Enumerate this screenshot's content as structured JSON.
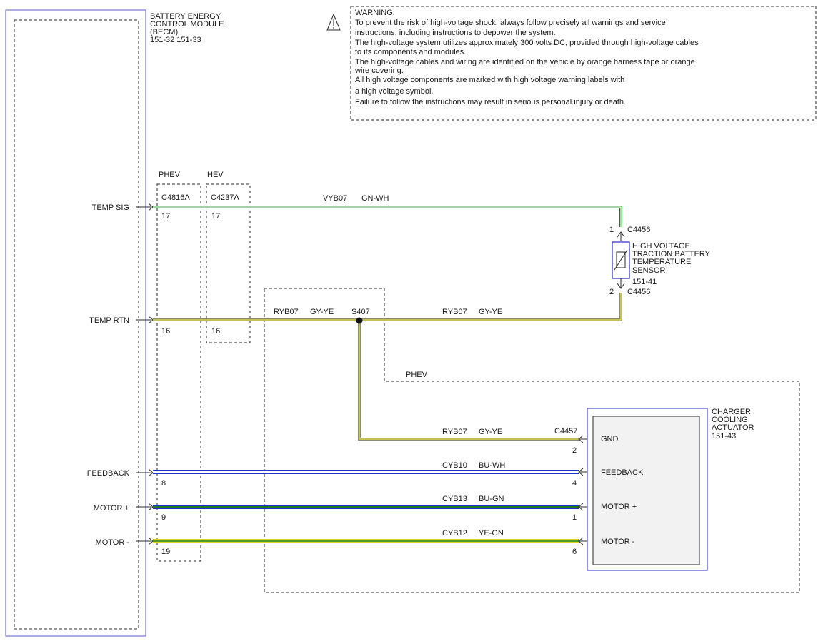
{
  "module_becm": {
    "title_lines": [
      "BATTERY ENERGY",
      "CONTROL MODULE",
      "(BECM)",
      "151-32  151-33"
    ]
  },
  "warning": {
    "title": "WARNING:",
    "lines": [
      "To prevent the risk of high-voltage shock, always follow precisely all warnings and service",
      "instructions, including instructions to depower the system.",
      "The high-voltage system utilizes approximately 300 volts DC, provided through high-voltage cables",
      "to its components and modules.",
      "The high-voltage cables and wiring are identified on the vehicle by orange harness tape or orange",
      "wire covering.",
      "All high voltage components are marked with high voltage warning labels with",
      "a high voltage symbol.",
      "Failure to follow the instructions may result in serious personal injury or death."
    ]
  },
  "option_labels": {
    "phev": "PHEV",
    "hev": "HEV",
    "phev_zone": "PHEV"
  },
  "connectors": {
    "c4816a": "C4816A",
    "c4237a": "C4237A",
    "c4456_top": "C4456",
    "c4456_bottom": "C4456",
    "c4457": "C4457"
  },
  "splice": "S407",
  "signals": [
    "TEMP SIG",
    "TEMP RTN",
    "FEEDBACK",
    "MOTOR +",
    "MOTOR -"
  ],
  "becm_pins": {
    "phev": [
      "17",
      "16",
      "8",
      "9",
      "19"
    ],
    "hev": [
      "17",
      "16"
    ]
  },
  "sensor": {
    "name_lines": [
      "HIGH VOLTAGE",
      "TRACTION BATTERY",
      "TEMPERATURE",
      "SENSOR",
      "151-41"
    ],
    "pin_top": "1",
    "pin_bottom": "2"
  },
  "actuator": {
    "name_lines": [
      "CHARGER",
      "COOLING",
      "ACTUATOR",
      "151-43"
    ],
    "pin_labels": [
      "GND",
      "FEEDBACK",
      "MOTOR +",
      "MOTOR -"
    ],
    "pin_numbers": [
      "2",
      "4",
      "1",
      "6"
    ]
  },
  "wires": [
    {
      "circuit": "VYB07",
      "color_code": "GN-WH",
      "main": "#1f7a1f",
      "stripe": "#ffffff"
    },
    {
      "circuit": "RYB07",
      "color_code": "GY-YE",
      "main": "#8a8a78",
      "stripe": "#e8df3a"
    },
    {
      "circuit": "RYB07",
      "color_code": "GY-YE",
      "main": "#8a8a78",
      "stripe": "#e8df3a"
    },
    {
      "circuit": "RYB07",
      "color_code": "GY-YE",
      "main": "#8a8a78",
      "stripe": "#e8df3a"
    },
    {
      "circuit": "CYB10",
      "color_code": "BU-WH",
      "main": "#2233cc",
      "stripe": "#ffffff"
    },
    {
      "circuit": "CYB13",
      "color_code": "BU-GN",
      "main": "#1a2ed1",
      "stripe": "#1f7a1f"
    },
    {
      "circuit": "CYB12",
      "color_code": "YE-GN",
      "main": "#d8d820",
      "stripe": "#4f9a2a"
    }
  ],
  "colors": {
    "module_border": "#5a5ad0",
    "text": "#1a1a1a"
  }
}
